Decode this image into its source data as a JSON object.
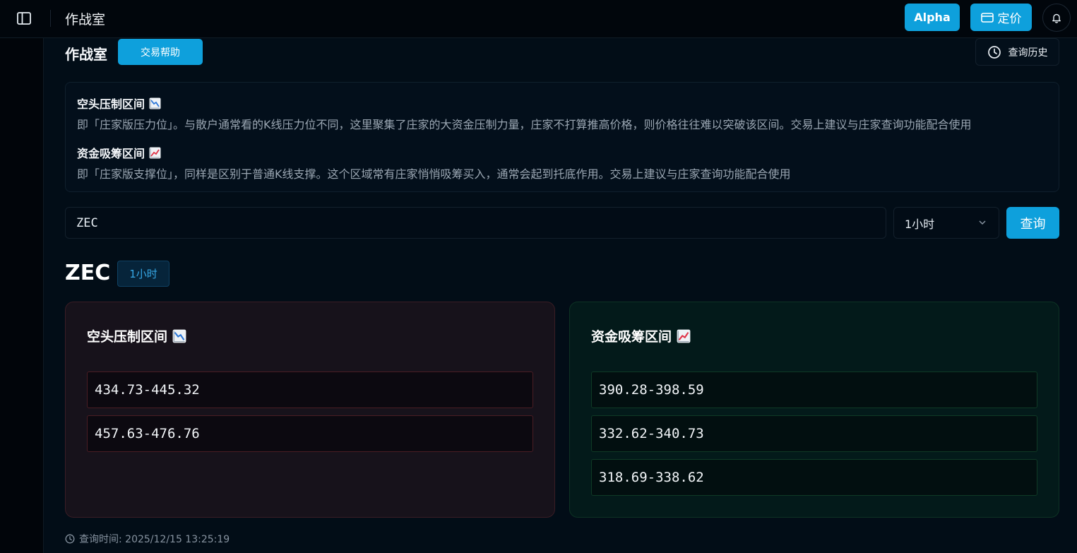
{
  "topbar": {
    "title": "作战室",
    "alpha_label": "Alpha",
    "pricing_label": "定价"
  },
  "header": {
    "title": "作战室",
    "help_label": "交易帮助",
    "history_label": "查询历史"
  },
  "info": {
    "bear_title": "空头压制区间",
    "bear_desc": "即「庄家版压力位」。与散户通常看的K线压力位不同，这里聚集了庄家的大资金压制力量，庄家不打算推高价格，则价格往往难以突破该区间。交易上建议与庄家查询功能配合使用",
    "bull_title": "资金吸筹区间",
    "bull_desc": "即「庄家版支撑位」，同样是区别于普通K线支撑。这个区域常有庄家悄悄吸筹买入，通常会起到托底作用。交易上建议与庄家查询功能配合使用"
  },
  "query": {
    "symbol_value": "ZEC",
    "timeframe": "1小时",
    "submit_label": "查询"
  },
  "result": {
    "symbol": "ZEC",
    "timeframe": "1小时",
    "bear_card_title": "空头压制区间",
    "bear_ranges": [
      "434.73-445.32",
      "457.63-476.76"
    ],
    "bull_card_title": "资金吸筹区间",
    "bull_ranges": [
      "390.28-398.59",
      "332.62-340.73",
      "318.69-338.62"
    ],
    "query_time": "查询时间: 2025/12/15 13:25:19"
  },
  "icons": {
    "sidebar_toggle": "sidebar-icon",
    "pricing": "card-icon",
    "bell": "bell-icon",
    "history": "clock-icon",
    "bear": "chart-decreasing-icon",
    "bull": "chart-increasing-icon",
    "chevron": "chevron-down-icon",
    "time": "clock-icon"
  },
  "colors": {
    "accent": "#0ea0dc",
    "background": "#020d17",
    "bear_border": "#4a1d24",
    "bull_border": "#0f3a26"
  }
}
